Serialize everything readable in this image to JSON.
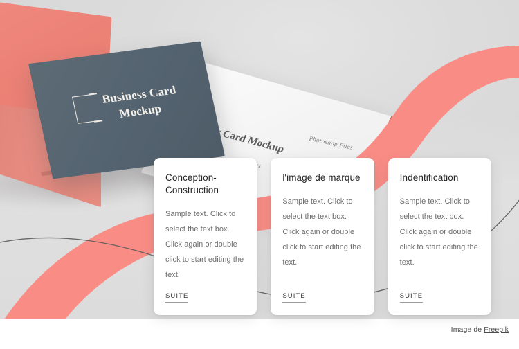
{
  "hero": {
    "mockup_card_front": {
      "logo_icon": "bracket-square-logo",
      "line1": "Business Card",
      "line2": "Mockup"
    },
    "mockup_card_back": {
      "title": "Business Card Mockup",
      "unit_label": "inches",
      "format_label": "Photoshop Files"
    },
    "colors": {
      "accent_pink": "#f98d86",
      "card_slate": "#556471",
      "cube_pink": "#ec8176",
      "backdrop_grey": "#dcdcdc",
      "wave_line": "#5d5b5c"
    }
  },
  "features": {
    "cards": [
      {
        "title": "Conception-Construction",
        "body": "Sample text. Click to select the text box. Click again or double click to start editing the text.",
        "link_label": "SUITE"
      },
      {
        "title": "l'image de marque",
        "body": "Sample text. Click to select the text box. Click again or double click to start editing the text.",
        "link_label": "SUITE"
      },
      {
        "title": "Indentification",
        "body": "Sample text. Click to select the text box. Click again or double click to start editing the text.",
        "link_label": "SUITE"
      }
    ]
  },
  "footer": {
    "credit_prefix": "Image de ",
    "credit_link": "Freepik"
  }
}
